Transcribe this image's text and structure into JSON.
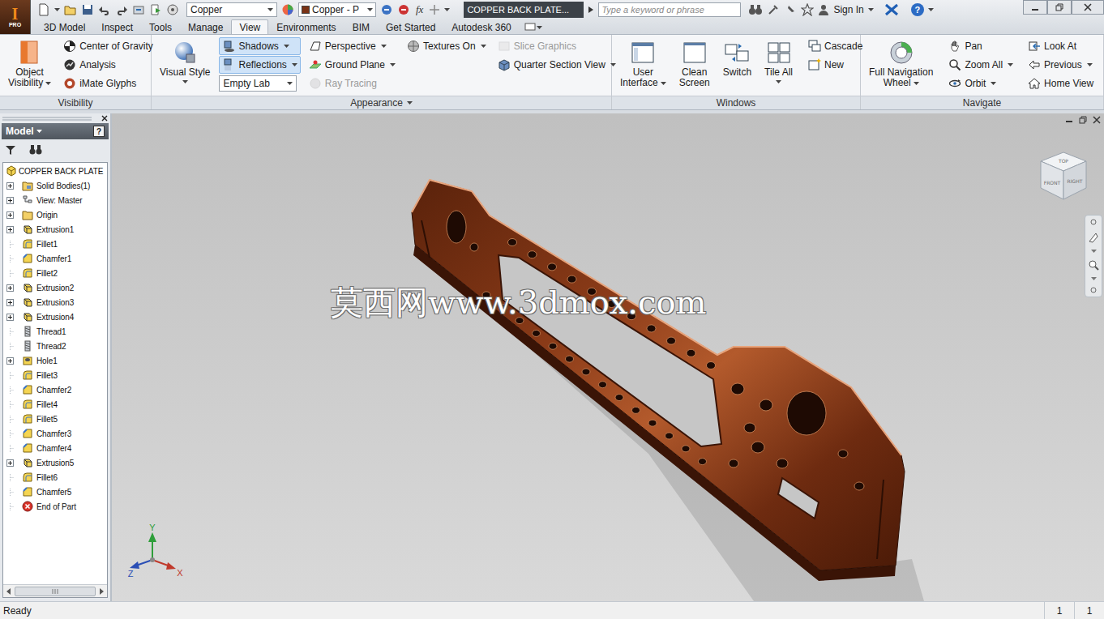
{
  "app": {
    "logo": "I",
    "edition": "PRO"
  },
  "quick_access": {
    "material": "Copper",
    "appearance": "Copper - P",
    "formula": "fx"
  },
  "window": {
    "title": "COPPER BACK PLATE..."
  },
  "search": {
    "placeholder": "Type a keyword or phrase"
  },
  "account": {
    "sign_in": "Sign In",
    "help": "?"
  },
  "tabs": [
    {
      "label": "3D Model",
      "selected": false
    },
    {
      "label": "Inspect",
      "selected": false
    },
    {
      "label": "Tools",
      "selected": false
    },
    {
      "label": "Manage",
      "selected": false
    },
    {
      "label": "View",
      "selected": true
    },
    {
      "label": "Environments",
      "selected": false
    },
    {
      "label": "BIM",
      "selected": false
    },
    {
      "label": "Get Started",
      "selected": false
    },
    {
      "label": "Autodesk 360",
      "selected": false
    }
  ],
  "ribbon": {
    "panels": [
      {
        "label": "Visibility",
        "menu": false,
        "groups": [
          {
            "kind": "row",
            "items": [
              {
                "kind": "large",
                "lines": [
                  "Object",
                  "Visibility"
                ],
                "dropdown": true,
                "selected": false,
                "disabled": false
              }
            ]
          },
          {
            "kind": "column",
            "items": [
              {
                "kind": "small",
                "label": "Center of Gravity",
                "dropdown": false,
                "selected": false,
                "disabled": false
              },
              {
                "kind": "small",
                "label": "Analysis",
                "dropdown": false,
                "selected": false,
                "disabled": false
              },
              {
                "kind": "small",
                "label": "iMate Glyphs",
                "dropdown": false,
                "selected": false,
                "disabled": false
              }
            ]
          }
        ]
      },
      {
        "label": "Appearance",
        "menu": true,
        "groups": [
          {
            "kind": "row",
            "items": [
              {
                "kind": "large",
                "lines": [
                  "Visual Style"
                ],
                "dropdown": true,
                "selected": false,
                "disabled": false
              }
            ]
          },
          {
            "kind": "column",
            "items": [
              {
                "kind": "small",
                "label": "Shadows",
                "dropdown": true,
                "selected": true,
                "disabled": false
              },
              {
                "kind": "small",
                "label": "Reflections",
                "dropdown": true,
                "selected": true,
                "disabled": false
              },
              {
                "kind": "combo",
                "value": "Empty Lab",
                "dropdown": true,
                "selected": false,
                "disabled": false
              }
            ]
          },
          {
            "kind": "column",
            "items": [
              {
                "kind": "small",
                "label": "Perspective",
                "dropdown": true,
                "selected": false,
                "disabled": false
              },
              {
                "kind": "small",
                "label": "Ground Plane",
                "dropdown": true,
                "selected": false,
                "disabled": false
              },
              {
                "kind": "small",
                "label": "Ray Tracing",
                "dropdown": false,
                "selected": false,
                "disabled": true
              }
            ]
          },
          {
            "kind": "column",
            "items": [
              {
                "kind": "small",
                "label": "Textures On",
                "dropdown": true,
                "selected": false,
                "disabled": false
              }
            ]
          },
          {
            "kind": "column",
            "items": [
              {
                "kind": "small",
                "label": "Slice Graphics",
                "dropdown": false,
                "selected": false,
                "disabled": true
              },
              {
                "kind": "small",
                "label": "Quarter Section View",
                "dropdown": true,
                "selected": false,
                "disabled": false
              }
            ]
          }
        ]
      },
      {
        "label": "Windows",
        "menu": false,
        "groups": [
          {
            "kind": "row",
            "items": [
              {
                "kind": "large",
                "lines": [
                  "User",
                  "Interface"
                ],
                "dropdown": true,
                "selected": false,
                "disabled": false
              },
              {
                "kind": "large",
                "lines": [
                  "Clean",
                  "Screen"
                ],
                "dropdown": false,
                "selected": false,
                "disabled": false
              },
              {
                "kind": "large",
                "lines": [
                  "Switch"
                ],
                "dropdown": false,
                "selected": false,
                "disabled": false
              },
              {
                "kind": "large",
                "lines": [
                  "Tile All"
                ],
                "dropdown": true,
                "selected": false,
                "disabled": false
              }
            ]
          },
          {
            "kind": "column",
            "items": [
              {
                "kind": "small",
                "label": "Cascade",
                "dropdown": false,
                "selected": false,
                "disabled": false
              },
              {
                "kind": "small",
                "label": "New",
                "dropdown": false,
                "selected": false,
                "disabled": false
              }
            ]
          }
        ]
      },
      {
        "label": "Navigate",
        "menu": false,
        "groups": [
          {
            "kind": "row",
            "items": [
              {
                "kind": "large",
                "lines": [
                  "Full Navigation",
                  "Wheel"
                ],
                "dropdown": true,
                "selected": false,
                "disabled": false
              }
            ]
          },
          {
            "kind": "column",
            "items": [
              {
                "kind": "small",
                "label": "Pan",
                "dropdown": false,
                "selected": false,
                "disabled": false
              },
              {
                "kind": "small",
                "label": "Zoom All",
                "dropdown": true,
                "selected": false,
                "disabled": false
              },
              {
                "kind": "small",
                "label": "Orbit",
                "dropdown": true,
                "selected": false,
                "disabled": false
              }
            ]
          },
          {
            "kind": "column",
            "items": [
              {
                "kind": "small",
                "label": "Look At",
                "dropdown": false,
                "selected": false,
                "disabled": false
              },
              {
                "kind": "small",
                "label": "Previous",
                "dropdown": true,
                "selected": false,
                "disabled": false
              },
              {
                "kind": "small",
                "label": "Home View",
                "dropdown": false,
                "selected": false,
                "disabled": false
              }
            ]
          }
        ]
      }
    ]
  },
  "browser": {
    "title": "Model",
    "help": "?",
    "items": [
      {
        "label": "COPPER BACK PLATE",
        "kind": "part",
        "has_children": false
      },
      {
        "label": "Solid Bodies(1)",
        "kind": "bodies",
        "has_children": true
      },
      {
        "label": "View: Master",
        "kind": "view",
        "has_children": true
      },
      {
        "label": "Origin",
        "kind": "origin",
        "has_children": true
      },
      {
        "label": "Extrusion1",
        "kind": "extrusion",
        "has_children": true
      },
      {
        "label": "Fillet1",
        "kind": "fillet",
        "has_children": false
      },
      {
        "label": "Chamfer1",
        "kind": "chamfer",
        "has_children": false
      },
      {
        "label": "Fillet2",
        "kind": "fillet",
        "has_children": false
      },
      {
        "label": "Extrusion2",
        "kind": "extrusion",
        "has_children": true
      },
      {
        "label": "Extrusion3",
        "kind": "extrusion",
        "has_children": true
      },
      {
        "label": "Extrusion4",
        "kind": "extrusion",
        "has_children": true
      },
      {
        "label": "Thread1",
        "kind": "thread",
        "has_children": false
      },
      {
        "label": "Thread2",
        "kind": "thread",
        "has_children": false
      },
      {
        "label": "Hole1",
        "kind": "hole",
        "has_children": true
      },
      {
        "label": "Fillet3",
        "kind": "fillet",
        "has_children": false
      },
      {
        "label": "Chamfer2",
        "kind": "chamfer",
        "has_children": false
      },
      {
        "label": "Fillet4",
        "kind": "fillet",
        "has_children": false
      },
      {
        "label": "Fillet5",
        "kind": "fillet",
        "has_children": false
      },
      {
        "label": "Chamfer3",
        "kind": "chamfer",
        "has_children": false
      },
      {
        "label": "Chamfer4",
        "kind": "chamfer",
        "has_children": false
      },
      {
        "label": "Extrusion5",
        "kind": "extrusion",
        "has_children": true
      },
      {
        "label": "Fillet6",
        "kind": "fillet",
        "has_children": false
      },
      {
        "label": "Chamfer5",
        "kind": "chamfer",
        "has_children": false
      },
      {
        "label": "End of Part",
        "kind": "end",
        "has_children": false
      }
    ]
  },
  "viewport": {
    "watermark": "莫西网www.3dmox.com",
    "viewcube": {
      "top": "TOP",
      "front": "FRONT",
      "right": "RIGHT"
    },
    "triad": {
      "x": "X",
      "y": "Y",
      "z": "Z"
    }
  },
  "status_bar": {
    "text": "Ready",
    "fields": [
      "1",
      "1"
    ]
  }
}
